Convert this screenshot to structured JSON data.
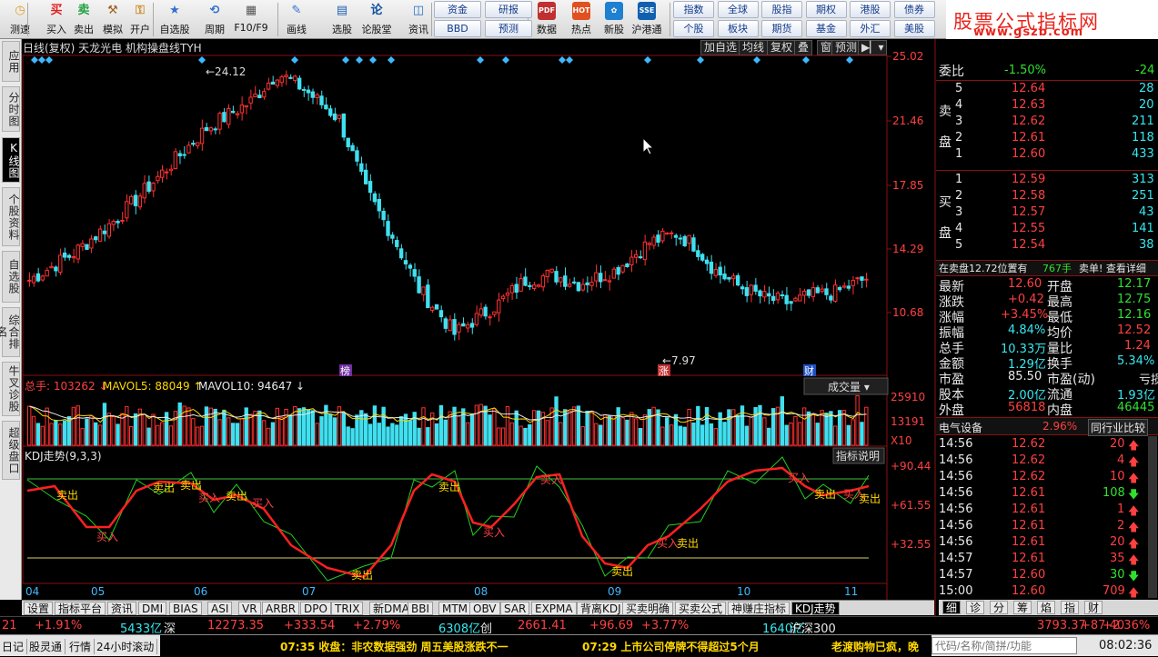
{
  "toolbar": {
    "buttons": [
      {
        "label": "测速",
        "icon": "clock-icon"
      },
      {
        "label": "买入",
        "icon": "buy-icon",
        "glyph": "买"
      },
      {
        "label": "卖出",
        "icon": "sell-icon",
        "glyph": "卖"
      },
      {
        "label": "模拟",
        "icon": "hammer-icon"
      },
      {
        "label": "开户",
        "icon": "lock-icon"
      },
      {
        "label": "自选股",
        "icon": "star-icon"
      },
      {
        "label": "周期",
        "icon": "cycle-icon"
      },
      {
        "label": "F10/F9",
        "icon": "info-icon"
      },
      {
        "label": "画线",
        "icon": "pen-icon"
      },
      {
        "label": "选股",
        "icon": "select-icon"
      },
      {
        "label": "论股堂",
        "icon": "forum-icon",
        "glyph": "论"
      },
      {
        "label": "资讯",
        "icon": "news-icon"
      }
    ],
    "grid1": [
      [
        "资金",
        "研报"
      ],
      [
        "BBD",
        "预测"
      ]
    ],
    "mid": [
      {
        "label": "数据",
        "icon": "pdf-icon",
        "glyph": "PDF"
      },
      {
        "label": "热点",
        "icon": "hot-icon",
        "glyph": "HOT"
      },
      {
        "label": "新股",
        "icon": "newstock-icon"
      },
      {
        "label": "沪港通",
        "icon": "hk-icon",
        "glyph": "SSE"
      }
    ],
    "grid2": [
      [
        "指数",
        "全球",
        "股指",
        "期权",
        "港股",
        "债券"
      ],
      [
        "个股",
        "板块",
        "期货",
        "基金",
        "外汇",
        "美股"
      ]
    ]
  },
  "brand": {
    "title": "股票公式指标网",
    "url": "www.gszb.com"
  },
  "left_tabs": [
    {
      "label": "应用",
      "active": false
    },
    {
      "label": "分时图",
      "active": false
    },
    {
      "label": "K线图",
      "active": true
    },
    {
      "label": "个股资料",
      "active": false
    },
    {
      "label": "自选股",
      "active": false
    },
    {
      "label": "综合排名",
      "active": false
    },
    {
      "label": "牛叉诊股",
      "active": false
    },
    {
      "label": "超级盘口",
      "active": false
    }
  ],
  "chart": {
    "title_name": "日线(复权) 天龙光电",
    "title_indicator": "机构操盘线TYH",
    "buttons": [
      "加自选",
      "均线",
      "复权",
      "叠",
      "窗",
      "预测"
    ],
    "price_axis": [
      "25.02",
      "21.46",
      "17.85",
      "14.29",
      "10.68"
    ],
    "high_label": "24.12",
    "low_label": "7.97",
    "markers": [
      "榜",
      "涨",
      "财"
    ],
    "vol_label": "总手: 103262",
    "mavol5": "MAVOL5: 88049",
    "mavol10": "MAVOL10: 94647",
    "vol_select": "成交量",
    "vol_axis": [
      "25910",
      "13191",
      "X10"
    ],
    "kdj_label": "KDJ走势(9,3,3)",
    "kdj_btn": "指标说明",
    "kdj_axis": [
      "+90.44",
      "+61.55",
      "+32.55"
    ],
    "kdj_tags": [
      "卖出",
      "买入",
      "卖出",
      "卖出",
      "买入",
      "卖出",
      "买入",
      "卖出",
      "卖出",
      "买入",
      "买入",
      "卖出",
      "买入",
      "卖出",
      "买入",
      "卖出",
      "买入",
      "卖出",
      "买入",
      "卖出",
      "买入",
      "买入"
    ],
    "months": [
      "04",
      "05",
      "06",
      "07",
      "08",
      "09",
      "10",
      "11"
    ]
  },
  "bottom_tabs": [
    "设置",
    "指标平台",
    "资讯",
    "DMI",
    "BIAS",
    "ASI",
    "VR",
    "ARBR",
    "DPO",
    "TRIX",
    "新DMA",
    "BBI",
    "MTM",
    "OBV",
    "SAR",
    "EXPMA",
    "背离KDJ",
    "买卖明确",
    "买卖公式",
    "神赚庄指标",
    "KDJ走势"
  ],
  "right_tabs": [
    "细",
    "诊",
    "分",
    "筹",
    "焰",
    "指",
    "财"
  ],
  "quote": {
    "weibi_label": "委比",
    "weibi": "-1.50%",
    "weicha": "-24",
    "sell": [
      {
        "n": "5",
        "p": "12.64",
        "v": "28"
      },
      {
        "n": "4",
        "p": "12.63",
        "v": "20"
      },
      {
        "n": "3",
        "p": "12.62",
        "v": "211"
      },
      {
        "n": "2",
        "p": "12.61",
        "v": "118"
      },
      {
        "n": "1",
        "p": "12.60",
        "v": "433"
      }
    ],
    "buy": [
      {
        "n": "1",
        "p": "12.59",
        "v": "313"
      },
      {
        "n": "2",
        "p": "12.58",
        "v": "251"
      },
      {
        "n": "3",
        "p": "12.57",
        "v": "43"
      },
      {
        "n": "4",
        "p": "12.55",
        "v": "141"
      },
      {
        "n": "5",
        "p": "12.54",
        "v": "38"
      }
    ],
    "sell_label": "卖盘",
    "buy_label": "买盘",
    "notice": "在卖盘12.72位置有",
    "notice_vol": "767手",
    "notice_tail": "卖单! 查看详细",
    "stats": [
      [
        "最新",
        "12.60",
        "开盘",
        "12.17"
      ],
      [
        "涨跌",
        "+0.42",
        "最高",
        "12.75"
      ],
      [
        "涨幅",
        "+3.45%",
        "最低",
        "12.16"
      ],
      [
        "振幅",
        "4.84%",
        "均价",
        "12.52"
      ],
      [
        "总手",
        "10.33万",
        "量比",
        "1.24"
      ],
      [
        "金额",
        "1.29亿",
        "换手",
        "5.34%"
      ],
      [
        "市盈",
        "85.50",
        "市盈(动)",
        "亏损"
      ],
      [
        "股本",
        "2.00亿",
        "流通",
        "1.93亿"
      ],
      [
        "外盘",
        "56818",
        "内盘",
        "46445"
      ]
    ],
    "sector": "电气设备",
    "sector_chg": "2.96%",
    "sector_btn": "同行业比较",
    "ticks": [
      [
        "14:56",
        "12.62",
        "20",
        "up"
      ],
      [
        "14:56",
        "12.62",
        "4",
        "up"
      ],
      [
        "14:56",
        "12.62",
        "10",
        "up"
      ],
      [
        "14:56",
        "12.61",
        "108",
        "down"
      ],
      [
        "14:56",
        "12.61",
        "1",
        "up"
      ],
      [
        "14:56",
        "12.61",
        "2",
        "up"
      ],
      [
        "14:56",
        "12.61",
        "20",
        "up"
      ],
      [
        "14:57",
        "12.61",
        "35",
        "up"
      ],
      [
        "14:57",
        "12.60",
        "30",
        "down"
      ],
      [
        "15:00",
        "12.60",
        "709",
        "up"
      ]
    ]
  },
  "status1": [
    "21",
    "+1.91%",
    "5433亿",
    "深",
    "12273.35",
    "+333.54",
    "+2.79%",
    "6308亿",
    "创",
    "2661.41",
    "+96.69",
    "+3.77%",
    "1640亿",
    "沪深300",
    "3793.37",
    "+87.40",
    "+2.36%"
  ],
  "status2": {
    "tabs": [
      "日记",
      "股灵通",
      "行情",
      "24小时滚动"
    ],
    "news1": "07:35 收盘：非农数据强劲 周五美股涨跌不一",
    "news2": "07:29 上市公司停牌不得超过5个月",
    "news3": "老渡购物已疯，晚",
    "search_placeholder": "代码/名称/简拼/功能",
    "time": "08:02:36"
  }
}
